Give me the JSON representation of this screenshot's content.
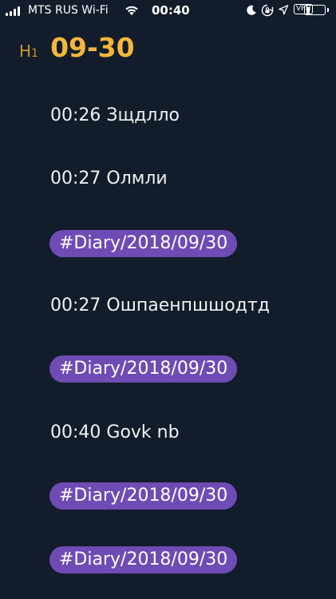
{
  "status_bar": {
    "carrier": "MTS RUS Wi-Fi",
    "time": "00:40",
    "vpn": "VPN",
    "battery_level": 0.3
  },
  "heading": {
    "marker": "H",
    "marker_level": "1",
    "title": "09-30"
  },
  "feed": [
    {
      "kind": "entry",
      "text": "00:26 Зщдлло"
    },
    {
      "kind": "entry",
      "text": "00:27 Олмли"
    },
    {
      "kind": "tag",
      "text": "#Diary/2018/09/30"
    },
    {
      "kind": "entry",
      "text": "00:27 Ошпаенпшшодтд"
    },
    {
      "kind": "tag",
      "text": "#Diary/2018/09/30"
    },
    {
      "kind": "entry",
      "text": "00:40 Govk nb"
    },
    {
      "kind": "tag",
      "text": "#Diary/2018/09/30"
    },
    {
      "kind": "tag",
      "text": "#Diary/2018/09/30"
    }
  ],
  "colors": {
    "background": "#131c2b",
    "heading": "#f4b73c",
    "marker": "#c9962e",
    "tag": "#6f4bb4"
  }
}
